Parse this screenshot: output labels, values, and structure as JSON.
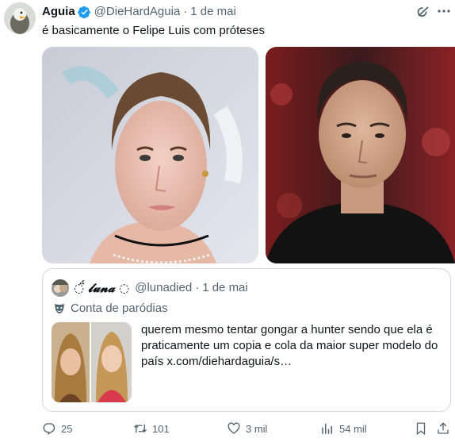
{
  "tweet": {
    "display_name": "Aguia",
    "handle": "@DieHardAguia",
    "separator": "·",
    "date": "1 de mai",
    "text": "é basicamente o Felipe Luis com próteses",
    "verified_color": "#1d9bf0"
  },
  "quote": {
    "display_name": "◌̈́ 𝓵𝓾𝓷𝓪 ◌",
    "handle": "@lunadied",
    "separator": "·",
    "date": "1 de mai",
    "label": "Conta de paródias",
    "text": "querem mesmo tentar gongar a hunter sendo que ela é praticamente um copia e cola da maior super modelo do país  x.com/diehardaguia/s…"
  },
  "actions": {
    "replies": "25",
    "retweets": "101",
    "likes": "3 mil",
    "views": "54 mil"
  },
  "icons": [
    "grok-icon",
    "more-icon",
    "verified-icon",
    "parody-icon",
    "reply-icon",
    "retweet-icon",
    "like-icon",
    "views-icon",
    "bookmark-icon",
    "share-icon"
  ]
}
